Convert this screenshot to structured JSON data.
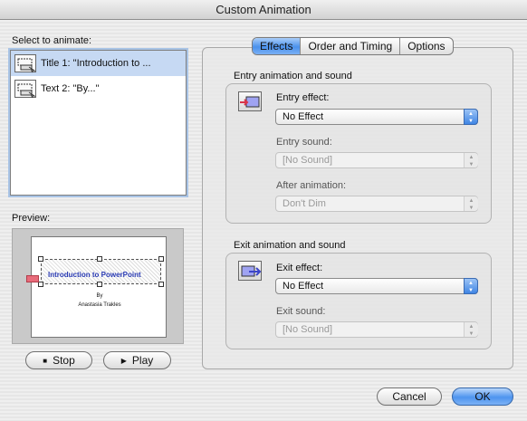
{
  "window": {
    "title": "Custom Animation"
  },
  "select_panel": {
    "label": "Select to animate:",
    "items": [
      {
        "label": "Title 1: \"Introduction to ...",
        "selected": true
      },
      {
        "label": "Text 2: \"By...\"",
        "selected": false
      }
    ]
  },
  "preview": {
    "label": "Preview:",
    "slide_title": "Introduction to PowerPoint",
    "slide_by": "By",
    "slide_author": "Anastasia Trakles"
  },
  "buttons": {
    "stop": "Stop",
    "play": "Play",
    "cancel": "Cancel",
    "ok": "OK"
  },
  "tabs": [
    {
      "label": "Effects",
      "active": true
    },
    {
      "label": "Order and Timing",
      "active": false
    },
    {
      "label": "Options",
      "active": false
    }
  ],
  "entry": {
    "group_label": "Entry animation and sound",
    "effect_label": "Entry effect:",
    "effect_value": "No Effect",
    "sound_label": "Entry sound:",
    "sound_value": "[No Sound]",
    "after_label": "After animation:",
    "after_value": "Don't Dim"
  },
  "exit": {
    "group_label": "Exit animation and sound",
    "effect_label": "Exit effect:",
    "effect_value": "No Effect",
    "sound_label": "Exit sound:",
    "sound_value": "[No Sound]"
  },
  "colors": {
    "accent": "#4e94ef",
    "selection": "#c6d9f3",
    "slide_title": "#2a3bb4"
  },
  "icons": {
    "list_item": "slide-object-icon",
    "entry": "entry-animation-icon",
    "exit": "exit-animation-icon",
    "stop": "stop-icon",
    "play": "play-icon",
    "popup": "popup-arrows-icon"
  }
}
